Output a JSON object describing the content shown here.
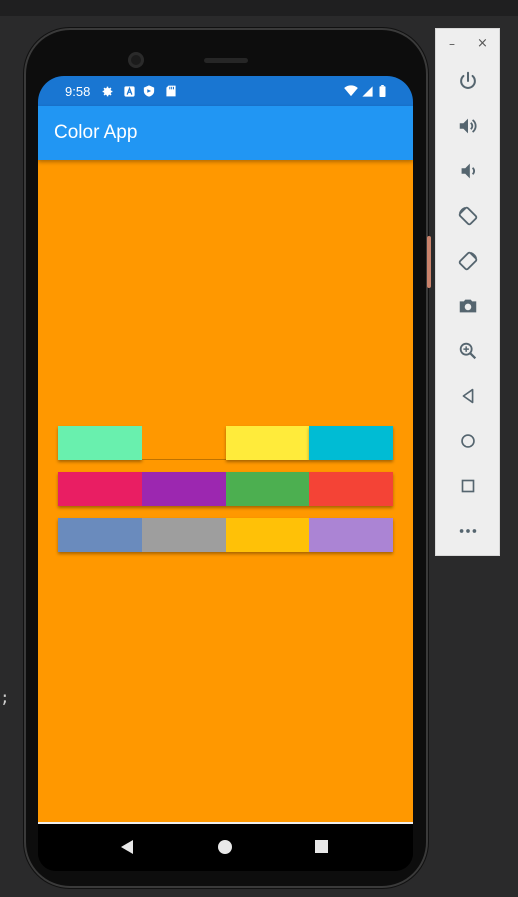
{
  "status_bar": {
    "time": "9:58"
  },
  "app_bar": {
    "title": "Color App"
  },
  "tile_rows": [
    {
      "tiles": [
        {
          "name": "mint",
          "color": "#69f0ae"
        },
        {
          "name": "orange-empty",
          "color": "#ff9800"
        },
        {
          "name": "yellow",
          "color": "#ffeb3b"
        },
        {
          "name": "cyan",
          "color": "#00bcd4"
        }
      ]
    },
    {
      "tiles": [
        {
          "name": "pink",
          "color": "#e91e63"
        },
        {
          "name": "purple",
          "color": "#9c27b0"
        },
        {
          "name": "green",
          "color": "#4caf50"
        },
        {
          "name": "red",
          "color": "#f44336"
        }
      ]
    },
    {
      "tiles": [
        {
          "name": "steel-blue",
          "color": "#6a8bbd"
        },
        {
          "name": "grey",
          "color": "#9e9e9e"
        },
        {
          "name": "amber",
          "color": "#ffc107"
        },
        {
          "name": "lavender",
          "color": "#ab84d4"
        }
      ]
    }
  ],
  "colors": {
    "background_orange": "#ff9800",
    "app_bar_blue": "#2196f3",
    "status_bar_blue": "#1976d2"
  },
  "emulator_toolbar": {
    "minimize_label": "–",
    "close_label": "×",
    "tools": [
      "power-icon",
      "volume-up-icon",
      "volume-down-icon",
      "rotate-left-icon",
      "rotate-right-icon",
      "camera-icon",
      "zoom-icon",
      "back-icon",
      "home-icon",
      "overview-icon",
      "more-icon"
    ]
  },
  "left_glyph": ";"
}
